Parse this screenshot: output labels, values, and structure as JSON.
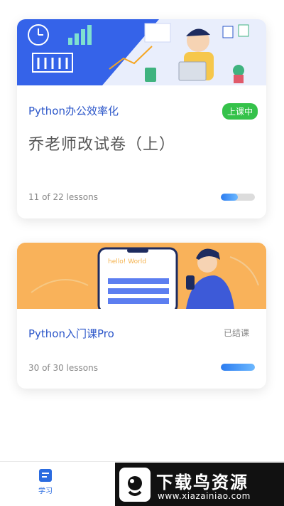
{
  "courses": [
    {
      "name": "Python办公效率化",
      "status": "上课中",
      "lesson_title": "乔老师改试卷（上）",
      "lessons": "11 of 22 lessons",
      "progress": 0.5
    },
    {
      "name": "Python入门课Pro",
      "status": "已结课",
      "banner_text": "hello! World",
      "lessons": "30 of 30 lessons",
      "progress": 1.0
    }
  ],
  "tabbar": {
    "study_label": "学习",
    "study_icon": "book-icon"
  },
  "watermark": {
    "title": "下载鸟资源",
    "url": "www.xiazainiao.com"
  },
  "colors": {
    "accent": "#2a55c9",
    "live_badge": "#35c24a",
    "banner2": "#f9b25a",
    "banner1": "#3563e9"
  }
}
